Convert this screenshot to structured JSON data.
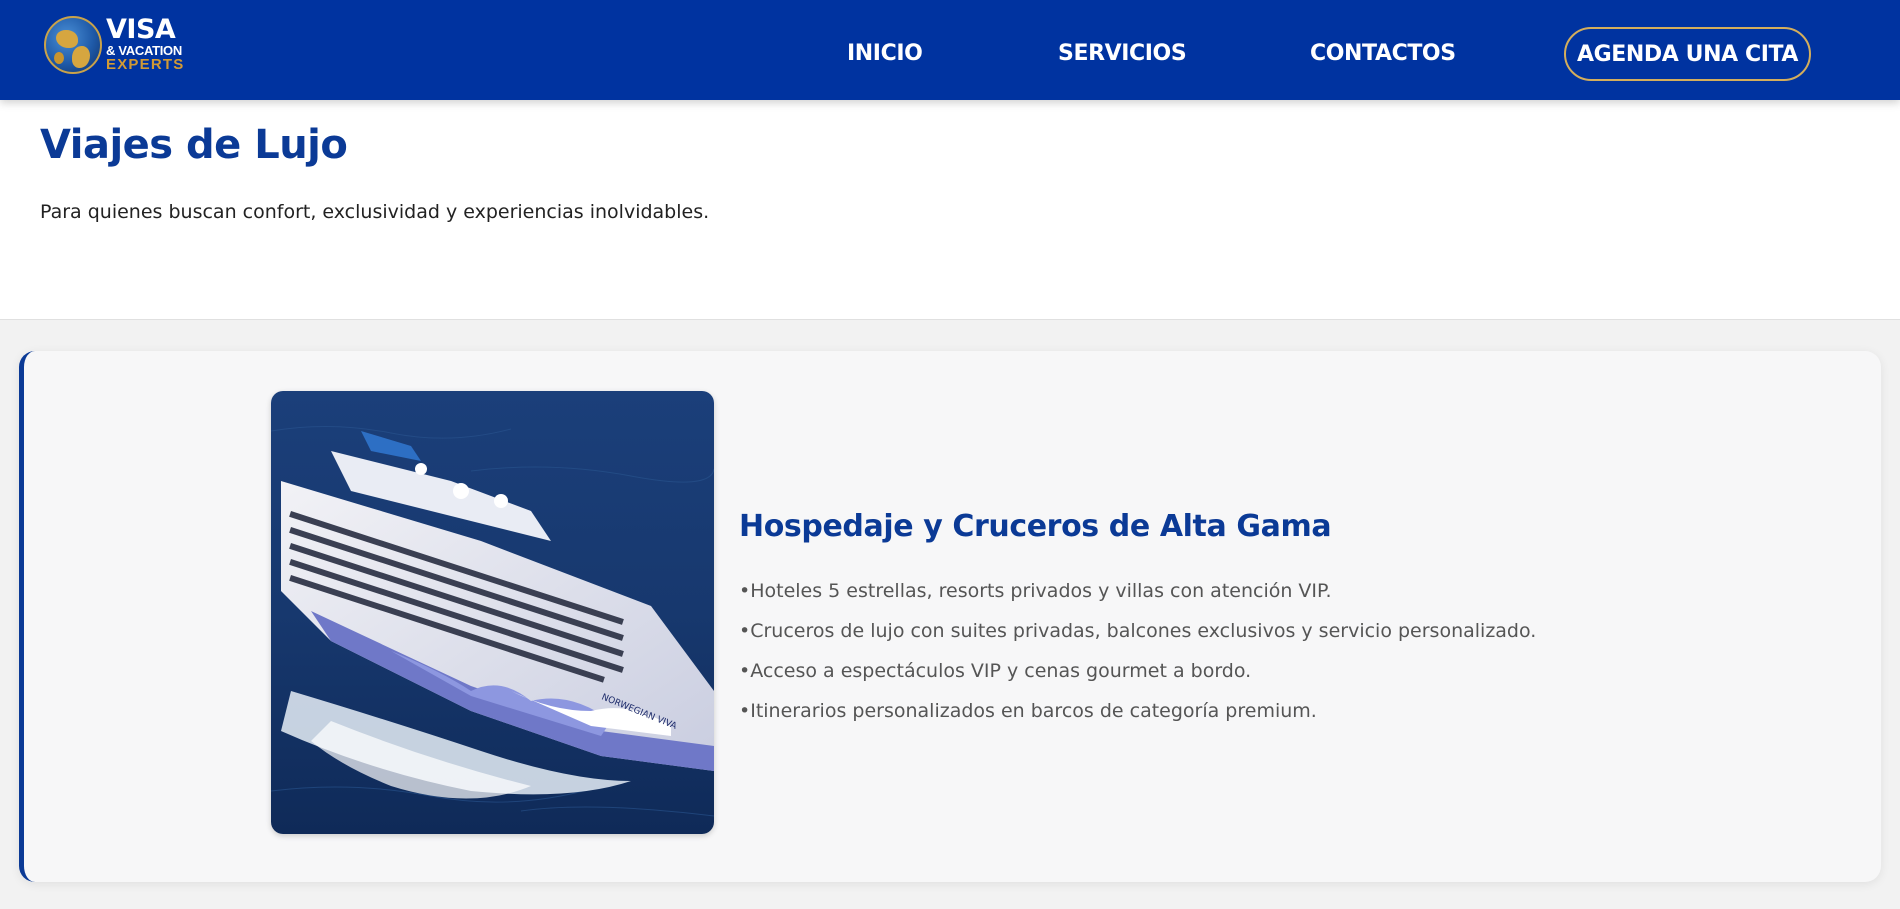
{
  "header": {
    "logo": {
      "line1": "VISA",
      "line2": "& VACATION",
      "line3": "EXPERTS"
    },
    "nav": [
      {
        "label": "INICIO"
      },
      {
        "label": "SERVICIOS"
      },
      {
        "label": "CONTACTOS"
      }
    ],
    "cta_label": "AGENDA UNA CITA"
  },
  "intro": {
    "title": "Viajes de Lujo",
    "subtitle": "Para quienes buscan confort, exclusividad y experiencias inolvidables."
  },
  "service_card": {
    "image_alt": "Crucero Norwegian Viva navegando en alta mar",
    "ship_name": "NORWEGIAN VIVA",
    "title": "Hospedaje y Cruceros de Alta Gama",
    "items": [
      "Hoteles 5 estrellas, resorts privados y villas con atención VIP.",
      "Cruceros de lujo con suites privadas, balcones exclusivos y servicio personalizado.",
      "Acceso a espectáculos VIP y cenas gourmet a bordo.",
      "Itinerarios personalizados en barcos de categoría premium."
    ]
  },
  "colors": {
    "header_bg": "#0033a0",
    "title_blue": "#0b3a96",
    "cta_border": "#d4ae5c",
    "logo_gold": "#d29a34",
    "page_bg": "#f2f2f2"
  }
}
